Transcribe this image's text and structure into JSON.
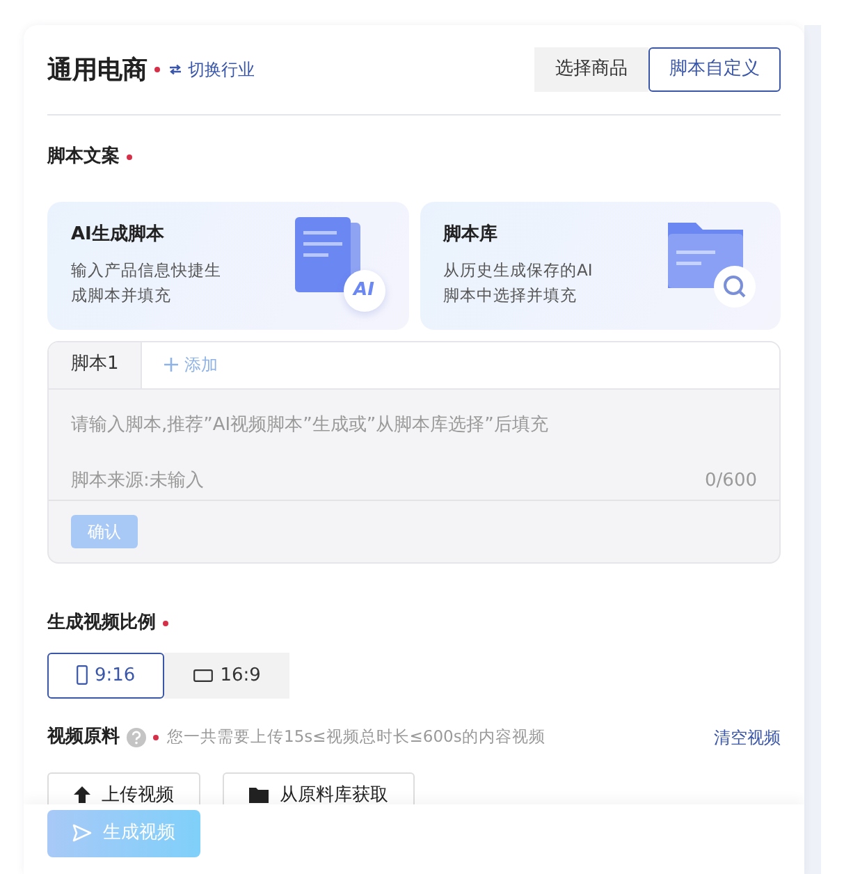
{
  "header": {
    "title": "通用电商",
    "required": true,
    "switch_link": "切换行业",
    "modes": [
      {
        "label": "选择商品",
        "selected": false
      },
      {
        "label": "脚本自定义",
        "selected": true
      }
    ]
  },
  "script_section": {
    "label": "脚本文案",
    "required": true,
    "sources": [
      {
        "kind": "ai",
        "title": "AI生成脚本",
        "description": "输入产品信息快捷生成脚本并填充",
        "badge": "AI"
      },
      {
        "kind": "library",
        "title": "脚本库",
        "description": "从历史生成保存的AI脚本中选择并填充"
      }
    ],
    "tabs": [
      {
        "label": "脚本1",
        "selected": true
      }
    ],
    "add_tab": "添加",
    "placeholder": "请输入脚本,推荐”AI视频脚本”生成或”从脚本库选择”后填充",
    "source_label": "脚本来源:未输入",
    "counter": "0/600",
    "confirm": {
      "label": "确认",
      "disabled": true
    }
  },
  "ratio_section": {
    "label": "生成视频比例",
    "required": true,
    "options": [
      {
        "kind": "portrait",
        "label": "9:16",
        "selected": true
      },
      {
        "kind": "landscape",
        "label": "16:9",
        "selected": false
      }
    ]
  },
  "material_section": {
    "label": "视频原料",
    "required": true,
    "hint": "您一共需要上传15s≤视频总时长≤600s的内容视频",
    "clear_link": "清空视频",
    "buttons": [
      {
        "kind": "upload",
        "label": "上传视频"
      },
      {
        "kind": "library",
        "label": "从原料库获取"
      }
    ]
  },
  "footer": {
    "generate": {
      "label": "生成视频",
      "disabled": true
    }
  }
}
